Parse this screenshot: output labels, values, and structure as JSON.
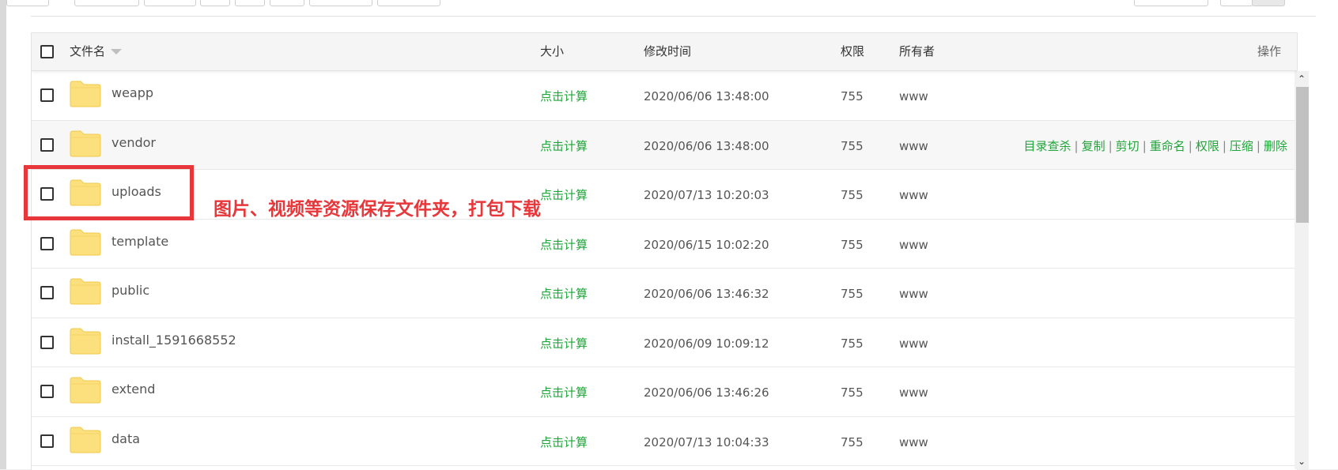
{
  "header": {
    "name": "文件名",
    "size": "大小",
    "modified": "修改时间",
    "permission": "权限",
    "owner": "所有者",
    "actions": "操作"
  },
  "size_label": "点击计算",
  "rows": [
    {
      "name": "weapp",
      "size": "点击计算",
      "time": "2020/06/06 13:48:00",
      "perm": "755",
      "owner": "www"
    },
    {
      "name": "vendor",
      "size": "点击计算",
      "time": "2020/06/06 13:48:00",
      "perm": "755",
      "owner": "www"
    },
    {
      "name": "uploads",
      "size": "点击计算",
      "time": "2020/07/13 10:20:03",
      "perm": "755",
      "owner": "www"
    },
    {
      "name": "template",
      "size": "点击计算",
      "time": "2020/06/15 10:02:20",
      "perm": "755",
      "owner": "www"
    },
    {
      "name": "public",
      "size": "点击计算",
      "time": "2020/06/06 13:46:32",
      "perm": "755",
      "owner": "www"
    },
    {
      "name": "install_1591668552",
      "size": "点击计算",
      "time": "2020/06/09 10:09:12",
      "perm": "755",
      "owner": "www"
    },
    {
      "name": "extend",
      "size": "点击计算",
      "time": "2020/06/06 13:46:26",
      "perm": "755",
      "owner": "www"
    },
    {
      "name": "data",
      "size": "点击计算",
      "time": "2020/07/13 10:04:33",
      "perm": "755",
      "owner": "www"
    }
  ],
  "row_actions": [
    "目录查杀",
    "复制",
    "剪切",
    "重命名",
    "权限",
    "压缩",
    "删除"
  ],
  "row_actions_separator": "|",
  "annotation": "图片、视频等资源保存文件夹，打包下载",
  "colors": {
    "accent_green": "#20a53a",
    "annotation_red": "#e8373a",
    "folder_yellow": "#fce07e"
  },
  "icons": {
    "folder": "folder-icon",
    "sort": "sort-caret-icon",
    "scroll_up": "scroll-up-arrow-icon",
    "scroll_down": "scroll-down-arrow-icon"
  }
}
